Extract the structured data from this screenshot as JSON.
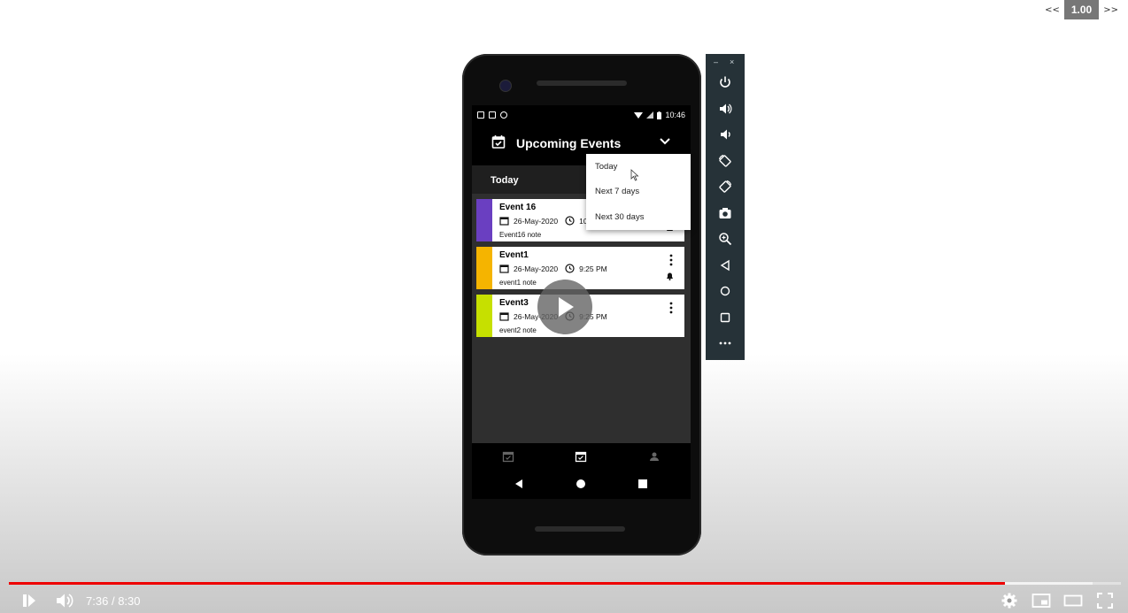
{
  "speed_control": {
    "prev": "<<",
    "value": "1.00",
    "next": ">>"
  },
  "status_bar": {
    "time": "10:46"
  },
  "app_bar": {
    "title": "Upcoming Events"
  },
  "section": {
    "title": "Today"
  },
  "events": [
    {
      "name": "Event 16",
      "date": "26-May-2020",
      "time": "10",
      "note": "Event16 note",
      "color": "#6a3fc1"
    },
    {
      "name": "Event1",
      "date": "26-May-2020",
      "time": "9:25 PM",
      "note": "event1 note",
      "color": "#f5b400"
    },
    {
      "name": "Event3",
      "date": "26-May-2020",
      "time": "9:25 PM",
      "note": "event2 note",
      "color": "#c6e000"
    }
  ],
  "dropdown": {
    "options": [
      "Today",
      "Next 7 days",
      "Next 30 days"
    ]
  },
  "emulator_toolbar": {
    "minimize": "–",
    "close": "×",
    "buttons": [
      "power-icon",
      "volume-up-icon",
      "volume-down-icon",
      "rotate-left-icon",
      "rotate-right-icon",
      "camera-icon",
      "zoom-icon",
      "back-icon",
      "home-icon",
      "overview-icon",
      "more-icon"
    ]
  },
  "video_player": {
    "current_time": "7:36",
    "separator": "/",
    "duration": "8:30",
    "time_display": "7:36 / 8:30",
    "progress": 0.894,
    "accent_color": "#ff0000"
  }
}
